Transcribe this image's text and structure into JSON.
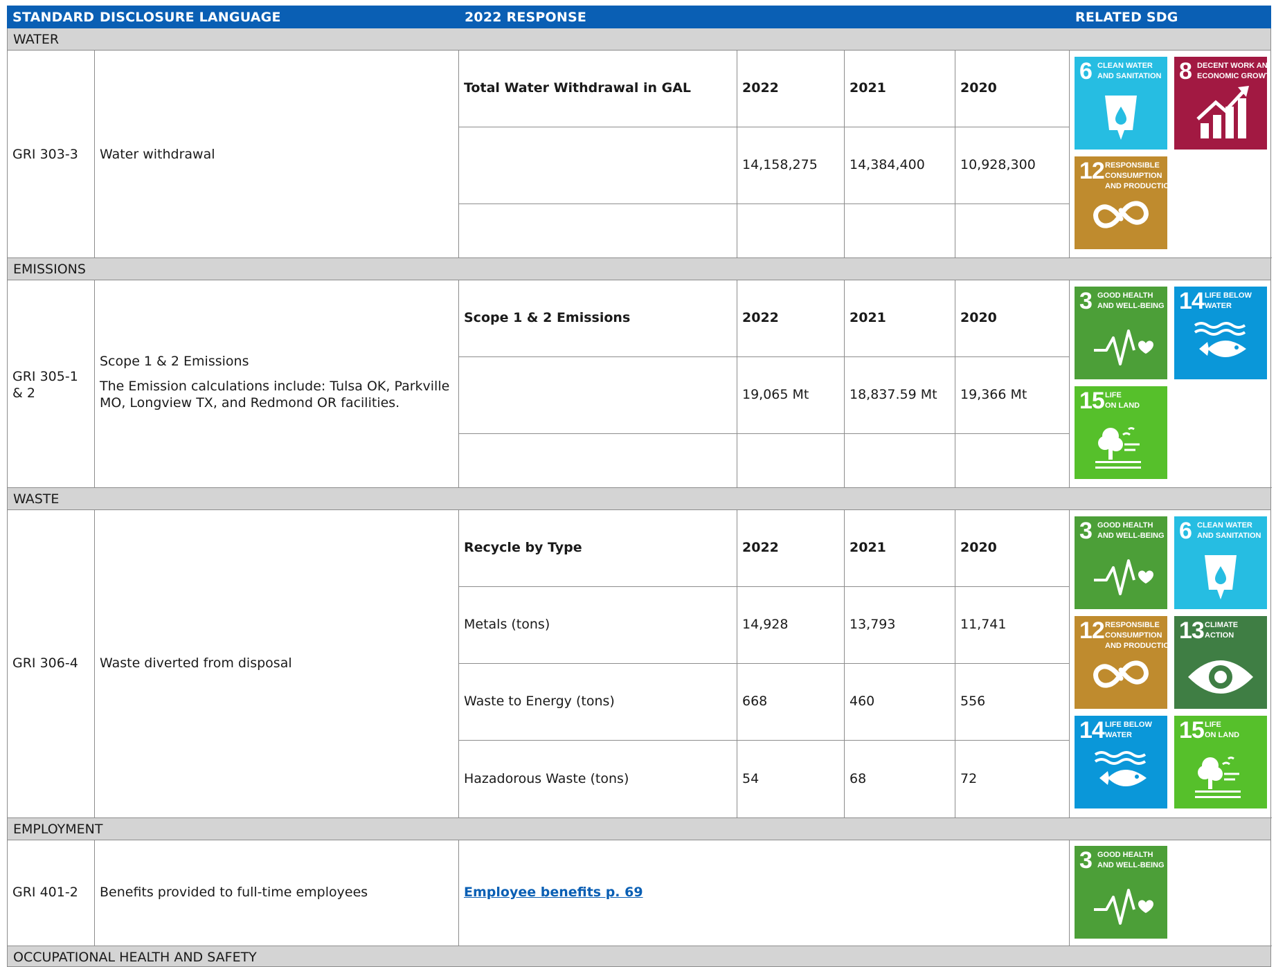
{
  "header": {
    "standard": "STANDARD",
    "disclosure": "DISCLOSURE LANGUAGE",
    "response": "2022 RESPONSE",
    "sdg": "RELATED SDG"
  },
  "sections": {
    "water": {
      "title": "WATER",
      "standard": "GRI 303-3",
      "disclosure": "Water withdrawal",
      "table": {
        "label": "Total Water Withdrawal in GAL",
        "years": [
          "2022",
          "2021",
          "2020"
        ],
        "values": [
          "14,158,275",
          "14,384,400",
          "10,928,300"
        ]
      }
    },
    "emissions": {
      "title": "EMISSIONS",
      "standard_line1": "GRI 305-1",
      "standard_line2": "& 2",
      "disclosure": "Scope 1 & 2 Emissions",
      "disclosure_note_line1": "The Emission calculations include: Tulsa OK, Parkville",
      "disclosure_note_line2": "MO, Longview TX,  and Redmond OR facilities.",
      "table": {
        "label": "Scope 1 & 2 Emissions",
        "years": [
          "2022",
          "2021",
          "2020"
        ],
        "values": [
          "19,065 Mt",
          "18,837.59 Mt",
          "19,366 Mt"
        ]
      }
    },
    "waste": {
      "title": "WASTE",
      "standard": "GRI 306-4",
      "disclosure": "Waste diverted from disposal",
      "table": {
        "label": "Recycle by Type",
        "years": [
          "2022",
          "2021",
          "2020"
        ],
        "rows": [
          {
            "label": "Metals (tons)",
            "values": [
              "14,928",
              "13,793",
              "11,741"
            ]
          },
          {
            "label": "Waste to Energy (tons)",
            "values": [
              "668",
              "460",
              "556"
            ]
          },
          {
            "label": "Hazadorous Waste (tons)",
            "values": [
              "54",
              "68",
              "72"
            ]
          }
        ]
      }
    },
    "employment": {
      "title": "EMPLOYMENT",
      "standard": "GRI 401-2",
      "disclosure": "Benefits provided to full-time employees",
      "link": "Employee benefits p. 69"
    },
    "ohs": {
      "title": "OCCUPATIONAL HEALTH AND SAFETY"
    }
  },
  "sdg_goals": {
    "g3": {
      "number": "3",
      "label": "GOOD HEALTH\nAND WELL-BEING",
      "color": "#4c9f38",
      "icon": "heartbeat-icon"
    },
    "g6": {
      "number": "6",
      "label": "CLEAN WATER\nAND SANITATION",
      "color": "#26bde2",
      "icon": "water-drop-icon"
    },
    "g8": {
      "number": "8",
      "label": "DECENT WORK AND\nECONOMIC GROWTH",
      "color": "#a21942",
      "icon": "growth-chart-icon"
    },
    "g12": {
      "number": "12",
      "label": "RESPONSIBLE\nCONSUMPTION\nAND PRODUCTION",
      "color": "#bf8b2e",
      "icon": "infinity-icon"
    },
    "g13": {
      "number": "13",
      "label": "CLIMATE\nACTION",
      "color": "#3f7e44",
      "icon": "eye-globe-icon"
    },
    "g14": {
      "number": "14",
      "label": "LIFE BELOW\nWATER",
      "color": "#0a97d9",
      "icon": "fish-icon"
    },
    "g15": {
      "number": "15",
      "label": "LIFE\nON LAND",
      "color": "#56c02b",
      "icon": "tree-icon"
    }
  }
}
